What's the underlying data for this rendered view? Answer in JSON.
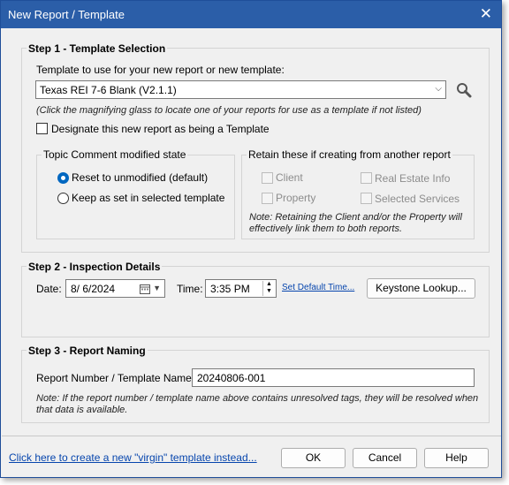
{
  "window": {
    "title": "New Report / Template",
    "close_glyph": "✕"
  },
  "step1": {
    "title": "Step 1 - Template Selection",
    "template_label": "Template to use for your new report or new template:",
    "template_value": "Texas REI 7-6 Blank (V2.1.1)",
    "search_icon": "magnifying-glass",
    "hint": "(Click the magnifying glass to locate one of your reports for use as a template if not listed)",
    "designate_label": "Designate this new report as being a Template",
    "designate_checked": false,
    "topic_group": {
      "title": "Topic Comment modified state",
      "options": [
        "Reset to unmodified (default)",
        "Keep as set in selected template"
      ],
      "selected": 0
    },
    "retain_group": {
      "title": "Retain these if creating from another report",
      "client": "Client",
      "real_estate": "Real Estate Info",
      "property": "Property",
      "services": "Selected Services",
      "note_line1": "Note: Retaining the Client and/or the Property will",
      "note_line2": "effectively link them to both reports."
    }
  },
  "step2": {
    "title": "Step 2 - Inspection Details",
    "date_label": "Date:",
    "date_value": "8/  6/2024",
    "time_label": "Time:",
    "time_value": "3:35 PM",
    "set_default_link": "Set Default Time...",
    "keystone_button": "Keystone Lookup..."
  },
  "step3": {
    "title": "Step 3 - Report Naming",
    "name_label": "Report Number / Template Name:",
    "name_value": "20240806-001",
    "note_line1": "Note: If the report number / template name above contains unresolved tags, they will be resolved when",
    "note_line2": "that data is available."
  },
  "footer": {
    "virgin_link": "Click here to create a new \"virgin\" template instead...",
    "ok": "OK",
    "cancel": "Cancel",
    "help": "Help"
  }
}
